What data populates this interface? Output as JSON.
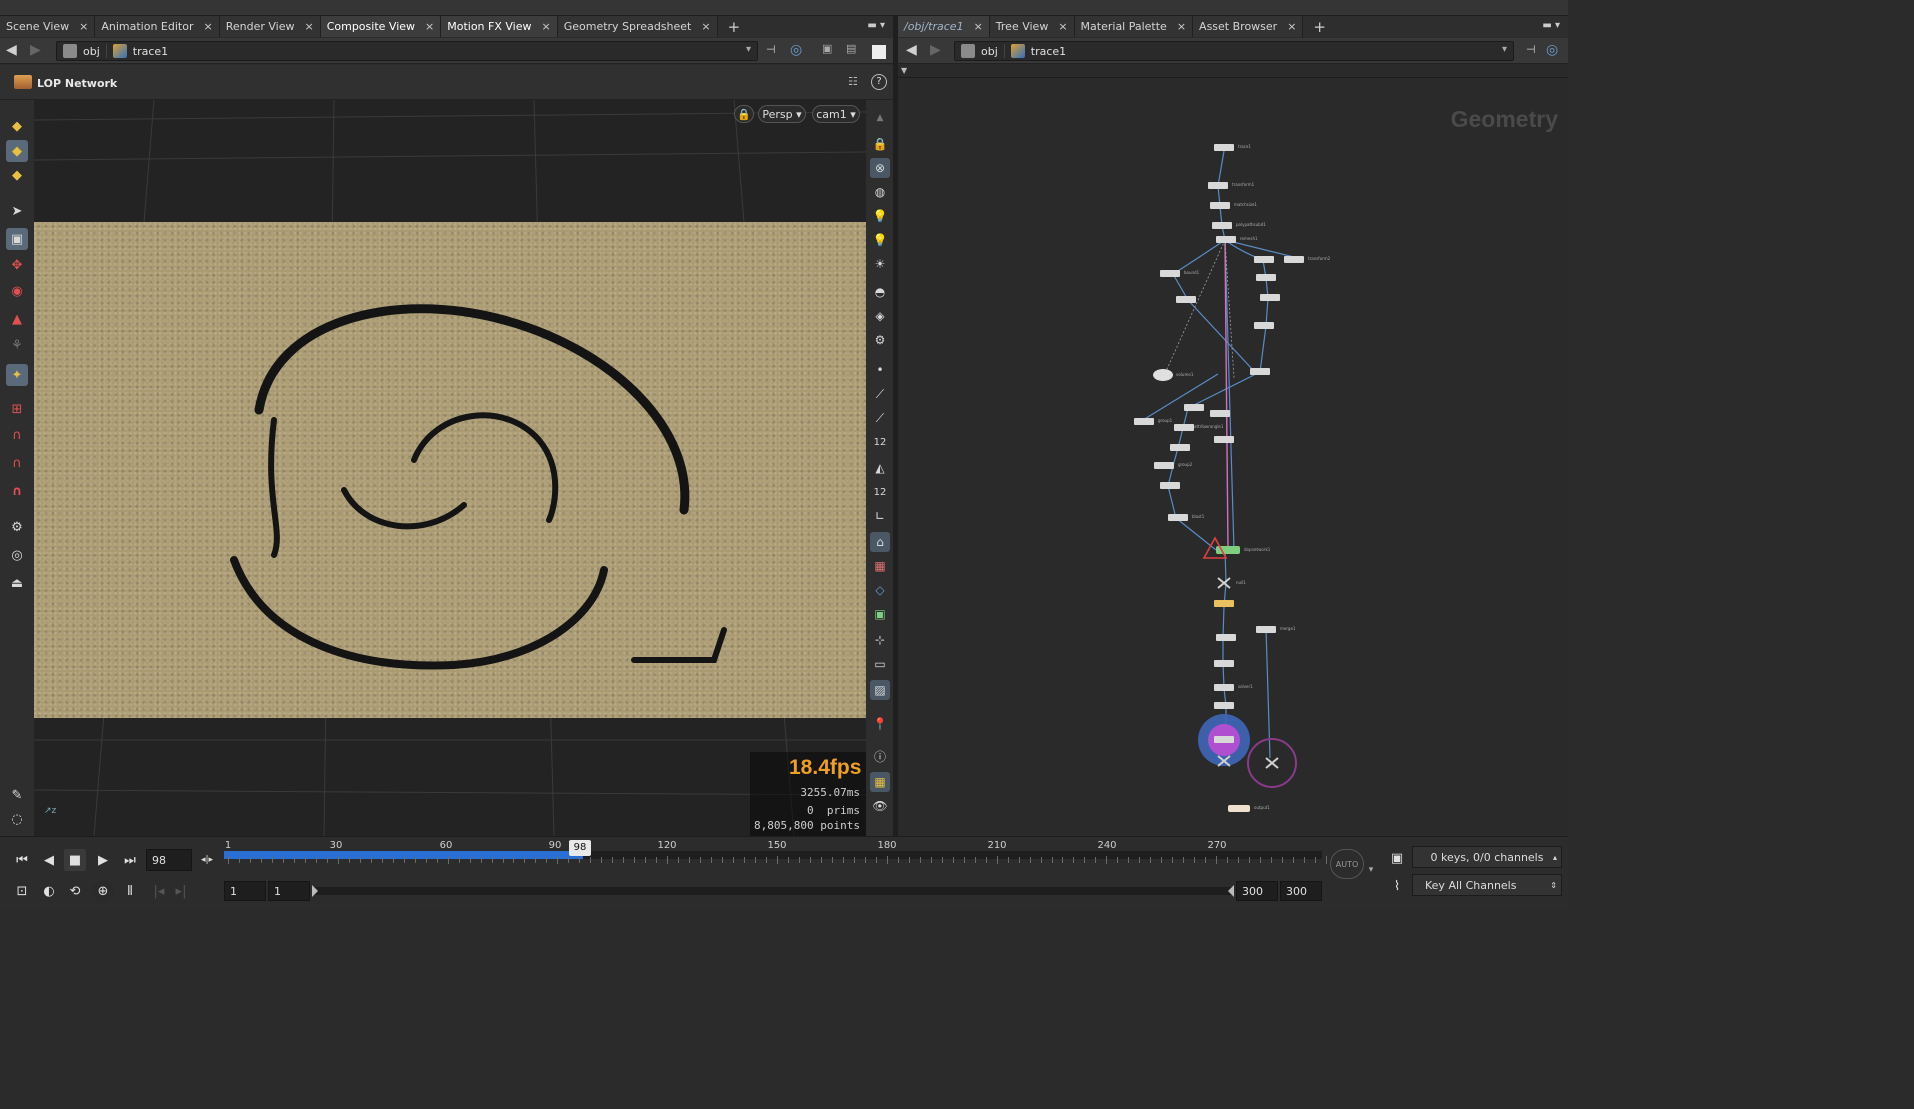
{
  "left_tabs": [
    {
      "label": "Scene View",
      "active": false
    },
    {
      "label": "Animation Editor",
      "active": false
    },
    {
      "label": "Render View",
      "active": false
    },
    {
      "label": "Composite View",
      "active": true
    },
    {
      "label": "Motion FX View",
      "active": true
    },
    {
      "label": "Geometry Spreadsheet",
      "active": false
    }
  ],
  "right_tabs": [
    {
      "label": "/obj/trace1",
      "active": true
    },
    {
      "label": "Tree View",
      "active": false
    },
    {
      "label": "Material Palette",
      "active": false
    },
    {
      "label": "Asset Browser",
      "active": false
    }
  ],
  "left_path": {
    "root": "obj",
    "node": "trace1"
  },
  "right_path": {
    "root": "obj",
    "node": "trace1"
  },
  "viewer": {
    "network_label": "LOP Network",
    "camera_mode": "Persp",
    "camera": "cam1",
    "fps": "18.4fps",
    "frame_time": "3255.07ms",
    "prims_value": "0",
    "prims_label": "prims",
    "points_value": "8,805,800",
    "points_label": "points"
  },
  "network": {
    "context_label": "Geometry",
    "nodes": [
      "trace1",
      "transform1",
      "matchsize1",
      "polypathsubd1",
      "remesh1",
      "bound1",
      "transform2",
      "volume1",
      "group1",
      "group2",
      "attribwrangle1",
      "blast1",
      "dopnetwork1",
      "null1",
      "merge1",
      "solver1",
      "output1"
    ]
  },
  "timeline": {
    "current_frame": "98",
    "marker": "98",
    "ticks": [
      "1",
      "30",
      "60",
      "90",
      "120",
      "150",
      "180",
      "210",
      "240",
      "270"
    ],
    "range_start": "1",
    "range_start2": "1",
    "range_end": "300",
    "range_end2": "300",
    "progress_fraction": 0.327,
    "auto_label": "AUTO",
    "keys_label": "0 keys, 0/0 channels",
    "key_all_label": "Key All Channels"
  },
  "colors": {
    "accent_blue": "#2a6fd6",
    "fps_orange": "#f0a020",
    "sand": "#a99a72",
    "node_purple": "#8a4fc0"
  },
  "icons": [
    "back-arrow-icon",
    "forward-arrow-icon",
    "pin-icon",
    "help-icon",
    "lock-icon",
    "select-icon",
    "magnet-icon",
    "eye-icon",
    "play-icon",
    "stop-icon"
  ]
}
